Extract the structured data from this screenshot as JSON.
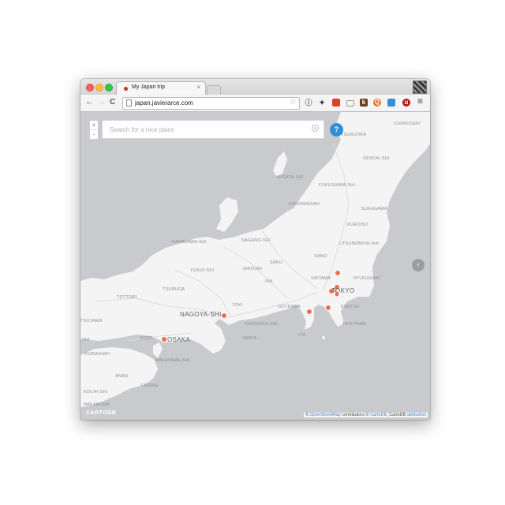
{
  "browser": {
    "tab_title": "My Japan trip",
    "tab_close": "×",
    "url": "japan.javierarce.com",
    "nav": {
      "back": "←",
      "forward": "→",
      "reload": "C"
    },
    "star": "☆",
    "menu": "≡",
    "extensions": [
      {
        "name": "info-icon",
        "glyph": "ⓘ",
        "color": "#555555"
      },
      {
        "name": "pin-icon",
        "glyph": "✦",
        "color": "#333333"
      },
      {
        "name": "grid-extension-icon",
        "glyph": "▦",
        "color": "#d9432f"
      },
      {
        "name": "cast-icon",
        "glyph": "▭",
        "color": "#888888"
      },
      {
        "name": "k-extension-icon",
        "glyph": "k",
        "color": "#6b3f1f"
      },
      {
        "name": "q-extension-icon",
        "glyph": "Q",
        "color": "#e0762b"
      },
      {
        "name": "screen-extension-icon",
        "glyph": "▣",
        "color": "#3a8fd4"
      },
      {
        "name": "u-extension-icon",
        "glyph": "u",
        "color": "#b01818"
      }
    ]
  },
  "map": {
    "search_placeholder": "Search for a nice place",
    "zoom_in": "+",
    "zoom_out": "-",
    "help": "?",
    "next": "‹",
    "labels": {
      "ichinoseki": "ICHINOSEKI",
      "tsuruoka": "TSURUOKA",
      "sendai": "SENDAI-SHI",
      "niigata": "NIIGATA-SHI",
      "fukushima": "FUKUSHIMA-SHI",
      "kashiwazaki": "KASHIWAZAKI",
      "sukagawa": "SUKAGAWA",
      "kanazawa": "KANAZAWA-SHI",
      "nagano": "NAGANO-SHI",
      "kuroiso": "KUROISO",
      "utsunomiya": "UTSUNOMIYA-SHI",
      "sano": "SANO",
      "saku": "SAKU",
      "fukui": "FUKUI-SHI",
      "shiojiri": "SHIOJIRI",
      "ryugasaki": "RYUGASAKI",
      "saitama": "SAITAMA",
      "ina": "INA",
      "tokyo": "TOKYO",
      "tsuruga": "TSURUGA",
      "tottori": "TOTTORI",
      "toki": "TOKI",
      "gotemba": "GOTEMBA",
      "kimitsu": "KIMITSU",
      "nagoya": "NAGOYA-SHI",
      "tsuyama": "TSUYAMA",
      "shizuoka": "SHIZUOKA-SHI",
      "tateyama": "TATEYAMA",
      "ito": "ITO",
      "kobe": "KOBE",
      "osaka": "OSAKA",
      "iwata": "IWATA",
      "kurashiki": "KURASHIKI",
      "wakayama": "WAKAYAMA-SHI",
      "anan": "ANAN",
      "tanabe": "TANABE",
      "kochi": "KOCHI-SHI",
      "nakamura": "NAKAMURA",
      "chi": "-SHI"
    },
    "markers_count": 9,
    "marker_color": "#f26b4f",
    "attribution": {
      "prefix": "© ",
      "osm": "OpenStreetMap",
      "mid": " contributors © ",
      "cartodb": "CartoDB",
      "mid2": ", CartoDB ",
      "attribution": "attribution"
    },
    "watermark": "CARTODB"
  }
}
